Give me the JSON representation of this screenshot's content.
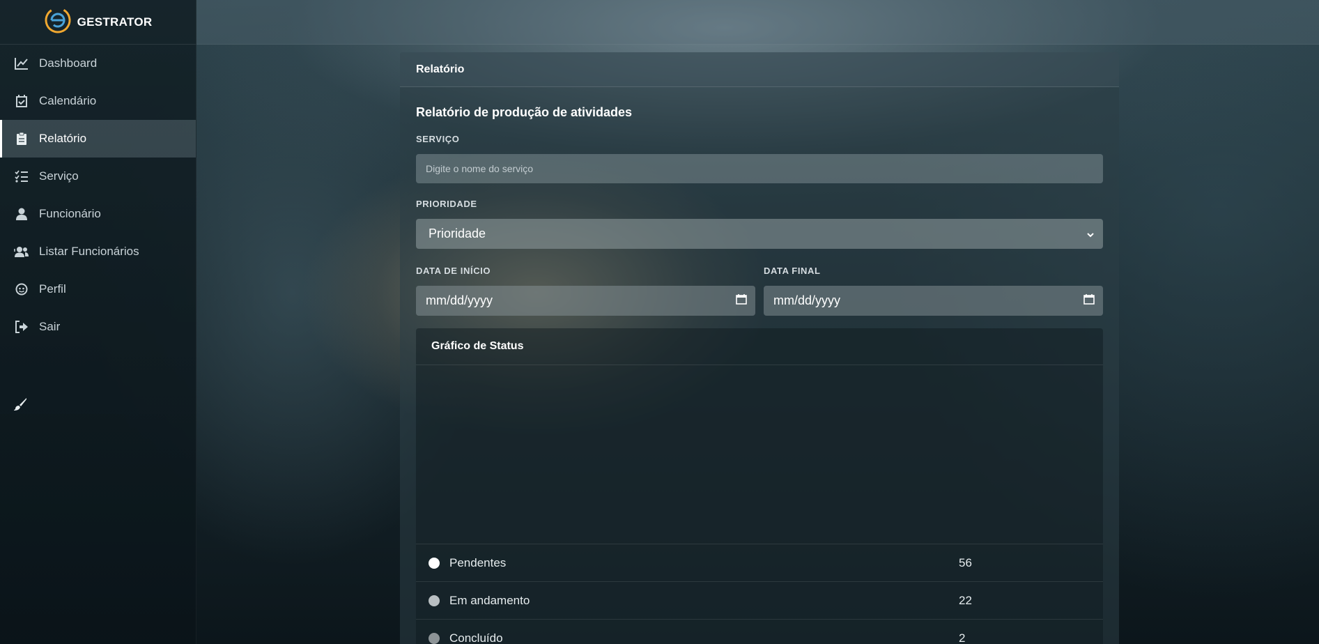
{
  "brand": {
    "name": "GESTRATOR"
  },
  "sidebar": {
    "items": [
      {
        "label": "Dashboard",
        "icon": "chart-line-icon"
      },
      {
        "label": "Calendário",
        "icon": "calendar-check-icon"
      },
      {
        "label": "Relatório",
        "icon": "clipboard-icon",
        "active": true
      },
      {
        "label": "Serviço",
        "icon": "list-check-icon"
      },
      {
        "label": "Funcionário",
        "icon": "user-icon"
      },
      {
        "label": "Listar Funcionários",
        "icon": "users-icon"
      },
      {
        "label": "Perfil",
        "icon": "face-icon"
      },
      {
        "label": "Sair",
        "icon": "sign-out-icon"
      }
    ],
    "extra_icon": "paint-brush-icon"
  },
  "card": {
    "header": "Relatório",
    "section_title": "Relatório de produção de atividades",
    "service": {
      "label": "SERVIÇO",
      "placeholder": "Digite o nome do serviço"
    },
    "priority": {
      "label": "PRIORIDADE",
      "selected": "Prioridade"
    },
    "start_date": {
      "label": "DATA DE INÍCIO",
      "value": "mm/dd/yyyy"
    },
    "end_date": {
      "label": "DATA FINAL",
      "value": "mm/dd/yyyy"
    }
  },
  "status_chart": {
    "title": "Gráfico de Status",
    "legend": [
      {
        "label": "Pendentes",
        "value": "56",
        "color": "#ffffff"
      },
      {
        "label": "Em andamento",
        "value": "22",
        "color": "#b9bfc2"
      },
      {
        "label": "Concluído",
        "value": "2",
        "color": "#8d9497"
      }
    ]
  },
  "colors": {
    "accent_orange": "#f0a830",
    "accent_blue": "#4aa3d8"
  }
}
